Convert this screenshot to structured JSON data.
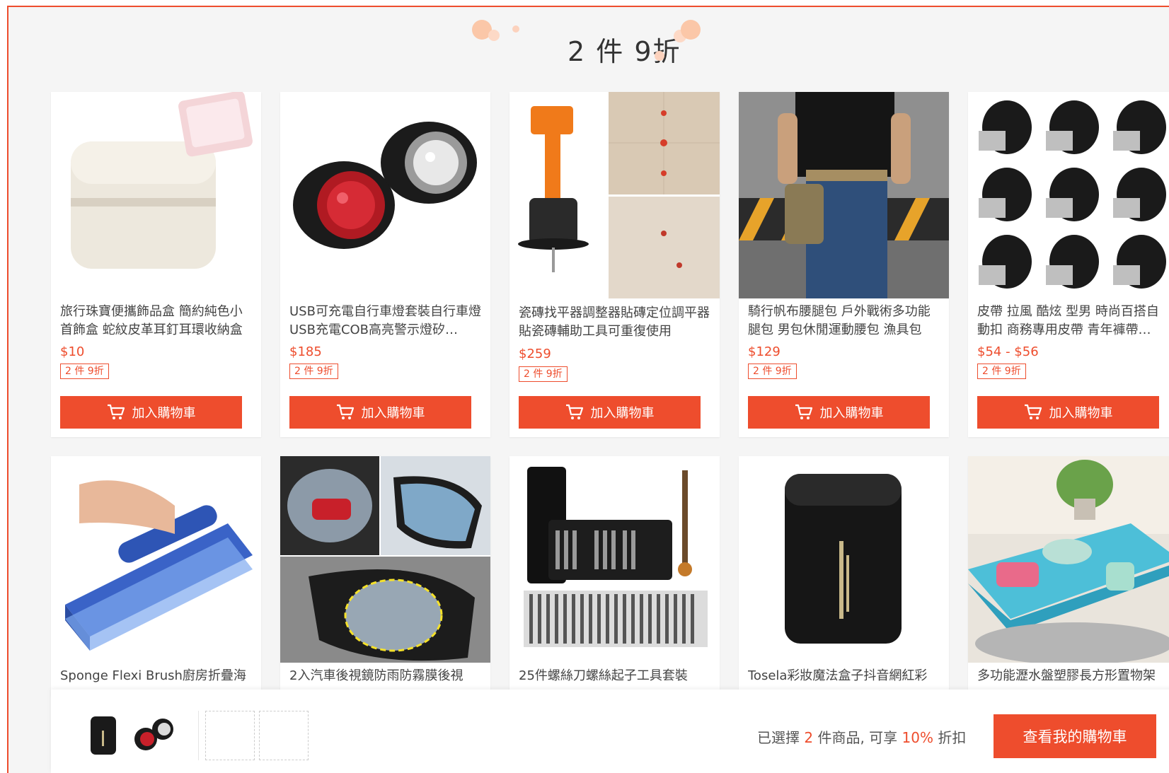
{
  "banner": {
    "title": "2 件 9折"
  },
  "colors": {
    "accent": "#ee4d2d",
    "background": "#f5f5f5"
  },
  "products": [
    {
      "title": "旅行珠寶便攜飾品盒 簡約純色小首飾盒 蛇紋皮革耳釘耳環收納盒",
      "price": "$10",
      "promo": "2 件 9折",
      "button": "加入購物車",
      "image": "jewelry-box"
    },
    {
      "title": "USB可充電自行車燈套裝自行車燈USB充電COB高亮警示燈矽…",
      "price": "$185",
      "promo": "2 件 9折",
      "button": "加入購物車",
      "image": "bike-light"
    },
    {
      "title": "瓷磚找平器調整器貼磚定位調平器貼瓷磚輔助工具可重復使用",
      "price": "$259",
      "promo": "2 件 9折",
      "button": "加入購物車",
      "image": "tile-leveler"
    },
    {
      "title": "騎行帆布腰腿包 戶外戰術多功能腿包 男包休閒運動腰包 漁具包",
      "price": "$129",
      "promo": "2 件 9折",
      "button": "加入購物車",
      "image": "leg-bag"
    },
    {
      "title": "皮帶 拉風 酷炫 型男 時尚百搭自動扣 商務專用皮帶 青年褲帶…",
      "price": "$54 - $56",
      "promo": "2 件 9折",
      "button": "加入購物車",
      "image": "belts"
    },
    {
      "title": "Sponge Flexi Brush廚房折疊海",
      "image": "sponge-brush"
    },
    {
      "title": "2入汽車後視鏡防雨防霧膜後視",
      "image": "mirror-film"
    },
    {
      "title": "25件螺絲刀螺絲起子工具套裝",
      "image": "screwdriver-set"
    },
    {
      "title": "Tosela彩妝魔法盒子抖音網紅彩",
      "image": "makeup-box"
    },
    {
      "title": "多功能瀝水盤塑膠長方形置物架",
      "image": "drain-tray"
    }
  ],
  "bottom_bar": {
    "selected_prefix": "已選擇",
    "selected_count": "2",
    "selected_mid": "件商品, 可享",
    "discount": "10%",
    "selected_suffix": "折扣",
    "view_cart": "查看我的購物車",
    "selected_thumbs": [
      "makeup-box",
      "bike-light"
    ]
  }
}
